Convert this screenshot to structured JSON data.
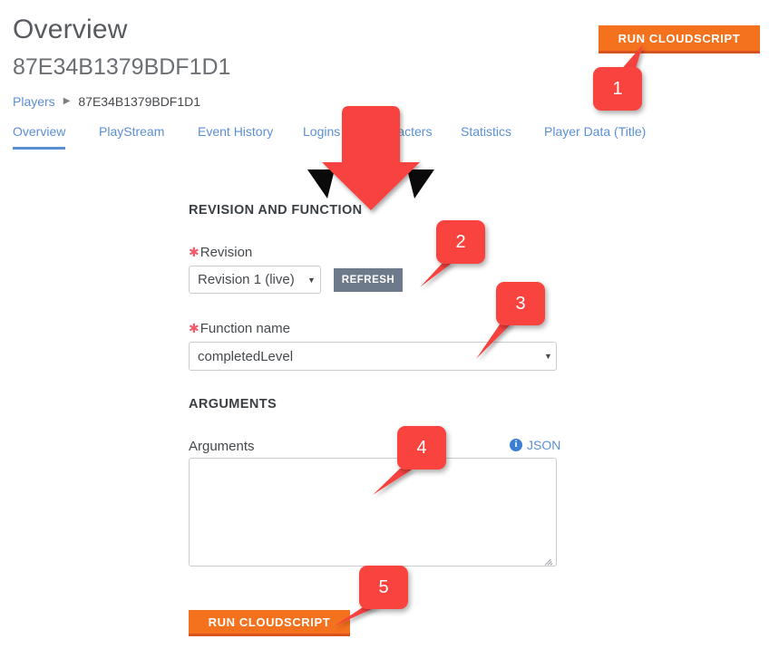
{
  "header": {
    "title": "Overview",
    "subtitle": "87E34B1379BDF1D1",
    "run_button_label": "RUN CLOUDSCRIPT"
  },
  "breadcrumb": {
    "parent": "Players",
    "separator": "▶",
    "current": "87E34B1379BDF1D1"
  },
  "tabs": [
    {
      "label": "Overview",
      "active": true
    },
    {
      "label": "PlayStream",
      "active": false
    },
    {
      "label": "Event History",
      "active": false
    },
    {
      "label": "Logins",
      "active": false
    },
    {
      "label": "Characters",
      "active": false
    },
    {
      "label": "Statistics",
      "active": false
    },
    {
      "label": "Player Data (Title)",
      "active": false
    }
  ],
  "revision_section": {
    "heading": "REVISION AND FUNCTION",
    "revision_label": "Revision",
    "revision_required_mark": "✱",
    "revision_value": "Revision 1 (live)",
    "revision_caret": "▼",
    "refresh_label": "REFRESH",
    "function_label": "Function name",
    "function_required_mark": "✱",
    "function_value": "completedLevel",
    "function_caret": "▼"
  },
  "arguments_section": {
    "heading": "ARGUMENTS",
    "label": "Arguments",
    "json_link_label": "JSON",
    "info_glyph": "i",
    "textarea_value": "",
    "textarea_placeholder": ""
  },
  "footer": {
    "run_button_label": "RUN CLOUDSCRIPT"
  },
  "annotations": {
    "callouts": [
      {
        "number": "1"
      },
      {
        "number": "2"
      },
      {
        "number": "3"
      },
      {
        "number": "4"
      },
      {
        "number": "5"
      }
    ]
  },
  "colors": {
    "orange_button": "#f4711e",
    "orange_button_border": "#d9531e",
    "link_blue": "#5b8fd4",
    "refresh_gray": "#6c7a89",
    "annotation_red": "#f8433f",
    "required_star": "#f05c6c"
  }
}
